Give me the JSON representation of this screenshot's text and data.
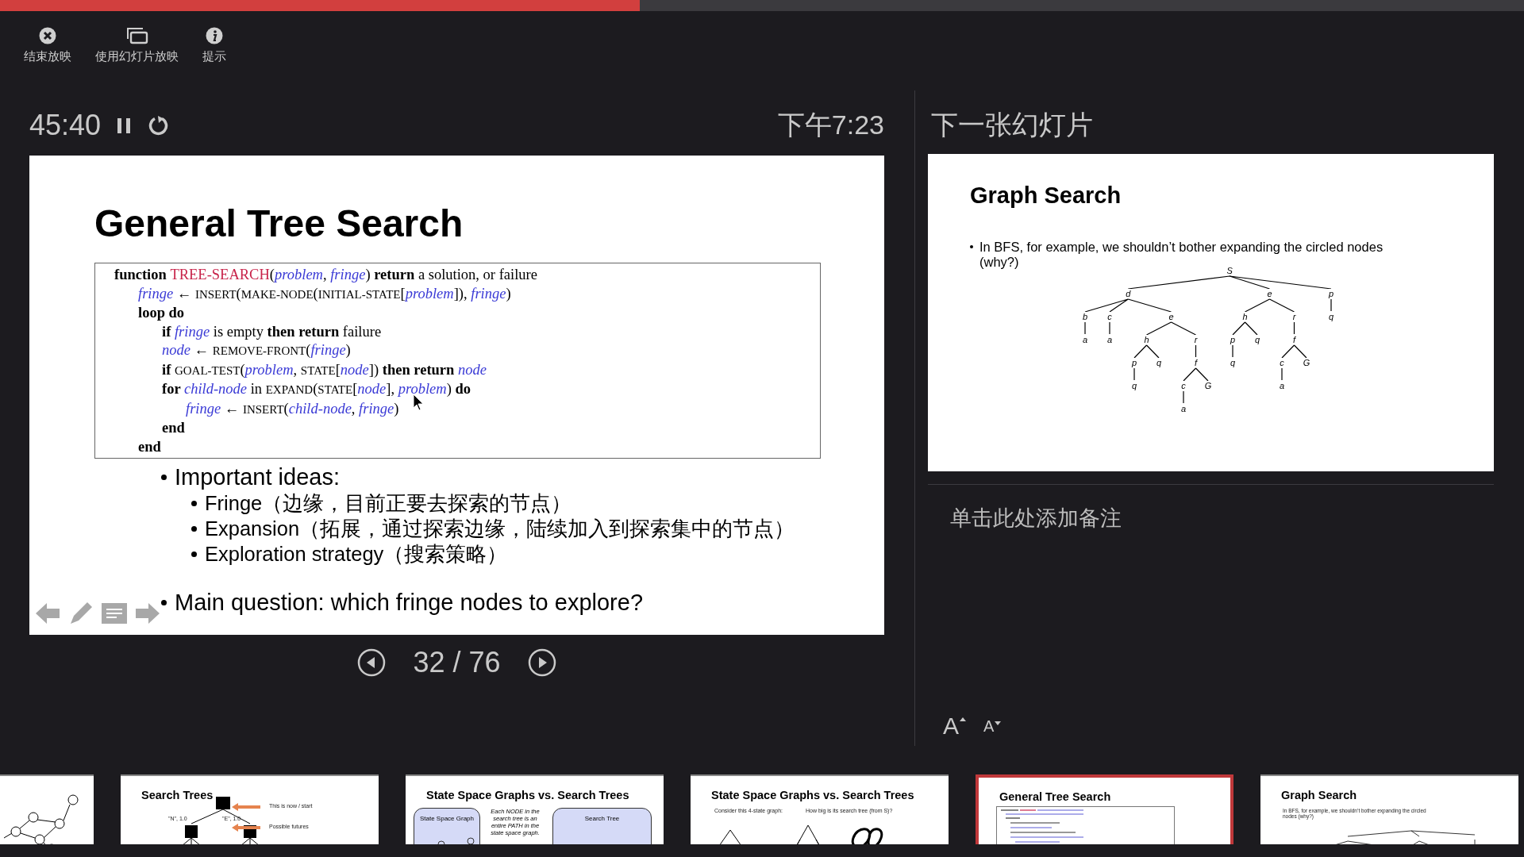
{
  "progress": {
    "level": 0.42
  },
  "toolbar": [
    {
      "label": "结束放映",
      "kind": "end"
    },
    {
      "label": "使用幻灯片放映",
      "kind": "display"
    },
    {
      "label": "提示",
      "kind": "help"
    }
  ],
  "timer": {
    "elapsed": "45:40",
    "clock": "下午7:23"
  },
  "current_slide": {
    "title": "General Tree Search",
    "code": [
      {
        "segments": [
          {
            "text": "function ",
            "kind": "kw"
          },
          {
            "text": "TREE-SEARCH",
            "kind": "name"
          },
          {
            "text": "(",
            "kind": "plain"
          },
          {
            "text": "problem",
            "kind": "var"
          },
          {
            "text": ", ",
            "kind": "plain"
          },
          {
            "text": "fringe",
            "kind": "var"
          },
          {
            "text": ") ",
            "kind": "plain"
          },
          {
            "text": "return",
            "kind": "kw"
          },
          {
            "text": " a solution, or failure",
            "kind": "plain"
          }
        ],
        "children": [
          {
            "segments": [
              {
                "text": "fringe",
                "kind": "var"
              },
              {
                "text": " ← ",
                "kind": "plain"
              },
              {
                "text": "INSERT",
                "kind": "fn"
              },
              {
                "text": "(",
                "kind": "plain"
              },
              {
                "text": "MAKE-NODE",
                "kind": "fn"
              },
              {
                "text": "(",
                "kind": "plain"
              },
              {
                "text": "INITIAL-STATE",
                "kind": "fn"
              },
              {
                "text": "[",
                "kind": "plain"
              },
              {
                "text": "problem",
                "kind": "var"
              },
              {
                "text": "]), ",
                "kind": "plain"
              },
              {
                "text": "fringe",
                "kind": "var"
              },
              {
                "text": ")",
                "kind": "plain"
              }
            ]
          },
          {
            "segments": [
              {
                "text": "loop do",
                "kind": "kw"
              }
            ],
            "children": [
              {
                "segments": [
                  {
                    "text": "if ",
                    "kind": "kw"
                  },
                  {
                    "text": "fringe",
                    "kind": "var"
                  },
                  {
                    "text": " is empty ",
                    "kind": "plain"
                  },
                  {
                    "text": "then return",
                    "kind": "kw"
                  },
                  {
                    "text": " failure",
                    "kind": "plain"
                  }
                ]
              },
              {
                "segments": [
                  {
                    "text": "node",
                    "kind": "var"
                  },
                  {
                    "text": " ← ",
                    "kind": "plain"
                  },
                  {
                    "text": "REMOVE-FRONT",
                    "kind": "fn"
                  },
                  {
                    "text": "(",
                    "kind": "plain"
                  },
                  {
                    "text": "fringe",
                    "kind": "var"
                  },
                  {
                    "text": ")",
                    "kind": "plain"
                  }
                ]
              },
              {
                "segments": [
                  {
                    "text": "if ",
                    "kind": "kw"
                  },
                  {
                    "text": "GOAL-TEST",
                    "kind": "fn"
                  },
                  {
                    "text": "(",
                    "kind": "plain"
                  },
                  {
                    "text": "problem",
                    "kind": "var"
                  },
                  {
                    "text": ", ",
                    "kind": "plain"
                  },
                  {
                    "text": "STATE",
                    "kind": "fn"
                  },
                  {
                    "text": "[",
                    "kind": "plain"
                  },
                  {
                    "text": "node",
                    "kind": "var"
                  },
                  {
                    "text": "]) ",
                    "kind": "plain"
                  },
                  {
                    "text": "then return ",
                    "kind": "kw"
                  },
                  {
                    "text": "node",
                    "kind": "var"
                  }
                ]
              },
              {
                "segments": [
                  {
                    "text": "for ",
                    "kind": "kw"
                  },
                  {
                    "text": "child-node",
                    "kind": "var"
                  },
                  {
                    "text": " in ",
                    "kind": "plain"
                  },
                  {
                    "text": "EXPAND",
                    "kind": "fn"
                  },
                  {
                    "text": "(",
                    "kind": "plain"
                  },
                  {
                    "text": "STATE",
                    "kind": "fn"
                  },
                  {
                    "text": "[",
                    "kind": "plain"
                  },
                  {
                    "text": "node",
                    "kind": "var"
                  },
                  {
                    "text": "], ",
                    "kind": "plain"
                  },
                  {
                    "text": "problem",
                    "kind": "var"
                  },
                  {
                    "text": ") ",
                    "kind": "plain"
                  },
                  {
                    "text": "do",
                    "kind": "kw"
                  }
                ],
                "children": [
                  {
                    "segments": [
                      {
                        "text": "fringe",
                        "kind": "var"
                      },
                      {
                        "text": " ← ",
                        "kind": "plain"
                      },
                      {
                        "text": "INSERT",
                        "kind": "fn"
                      },
                      {
                        "text": "(",
                        "kind": "plain"
                      },
                      {
                        "text": "child-node",
                        "kind": "var"
                      },
                      {
                        "text": ", ",
                        "kind": "plain"
                      },
                      {
                        "text": "fringe",
                        "kind": "var"
                      },
                      {
                        "text": ")",
                        "kind": "plain"
                      }
                    ]
                  }
                ]
              },
              {
                "segments": [
                  {
                    "text": "end",
                    "kind": "kw"
                  }
                ]
              }
            ]
          },
          {
            "segments": [
              {
                "text": "end",
                "kind": "kw"
              }
            ]
          }
        ]
      }
    ],
    "bullets": [
      {
        "text": "Important ideas:",
        "children": [
          {
            "text": "Fringe（边缘，目前正要去探索的节点）"
          },
          {
            "text": "Expansion（拓展，通过探索边缘，陆续加入到探索集中的节点）"
          },
          {
            "text": "Exploration strategy（搜索策略）"
          }
        ]
      },
      {
        "text": "Main question: which fringe nodes to explore?"
      }
    ]
  },
  "pager": {
    "text": "32 / 76"
  },
  "next_slide": {
    "heading": "下一张幻灯片",
    "title": "Graph Search",
    "bullets": [
      "In BFS, for example, we shouldn’t bother expanding the circled nodes (why?)"
    ],
    "tree": {
      "label": "S",
      "children": [
        {
          "label": "d",
          "children": [
            {
              "label": "b",
              "children": [
                {
                  "label": "a"
                }
              ]
            },
            {
              "label": "c",
              "children": [
                {
                  "label": "a"
                }
              ]
            },
            {
              "label": "e",
              "children": [
                {
                  "label": "h",
                  "children": [
                    {
                      "label": "p",
                      "children": [
                        {
                          "label": "q"
                        }
                      ]
                    },
                    {
                      "label": "q"
                    }
                  ]
                },
                {
                  "label": "r",
                  "children": [
                    {
                      "label": "f",
                      "children": [
                        {
                          "label": "c",
                          "children": [
                            {
                              "label": "a"
                            }
                          ]
                        },
                        {
                          "label": "G"
                        }
                      ]
                    }
                  ]
                }
              ]
            }
          ]
        },
        {
          "label": "e",
          "children": [
            {
              "label": "h",
              "children": [
                {
                  "label": "p",
                  "children": [
                    {
                      "label": "q"
                    }
                  ]
                },
                {
                  "label": "q"
                }
              ]
            },
            {
              "label": "r",
              "children": [
                {
                  "label": "f",
                  "children": [
                    {
                      "label": "c",
                      "children": [
                        {
                          "label": "a"
                        }
                      ]
                    },
                    {
                      "label": "G"
                    }
                  ]
                }
              ]
            }
          ]
        },
        {
          "label": "p",
          "children": [
            {
              "label": "q"
            }
          ]
        }
      ]
    }
  },
  "notes": {
    "placeholder": "单击此处添加备注"
  },
  "font_buttons": [
    {
      "label": "A",
      "kind": "increase"
    },
    {
      "label": "A",
      "kind": "decrease"
    }
  ],
  "thumbnails": [
    {
      "kind": "graph",
      "selected": false
    },
    {
      "kind": "search-trees",
      "selected": false,
      "title": "Search Trees",
      "labels": [
        "\"N\", 1.0",
        "\"E\", 1.0"
      ],
      "notes": [
        "This is now / start",
        "Possible futures"
      ]
    },
    {
      "kind": "graph-vs-tree",
      "selected": false,
      "title": "State Space Graphs vs. Search Trees",
      "boxes": [
        "State Space Graph",
        "Search Tree"
      ],
      "caption": "Each NODE in the search tree is an entire PATH in the state space graph."
    },
    {
      "kind": "four-state",
      "selected": false,
      "title": "State Space Graphs vs. Search Trees",
      "captions": [
        "Consider this 4-state graph:",
        "How big is its search tree (from S)?"
      ]
    },
    {
      "kind": "code",
      "selected": true,
      "title": "General Tree Search"
    },
    {
      "kind": "graph-search",
      "selected": false,
      "title": "Graph Search",
      "bullet": "In BFS, for example, we shouldn’t bother expanding the circled nodes (why?)"
    }
  ]
}
